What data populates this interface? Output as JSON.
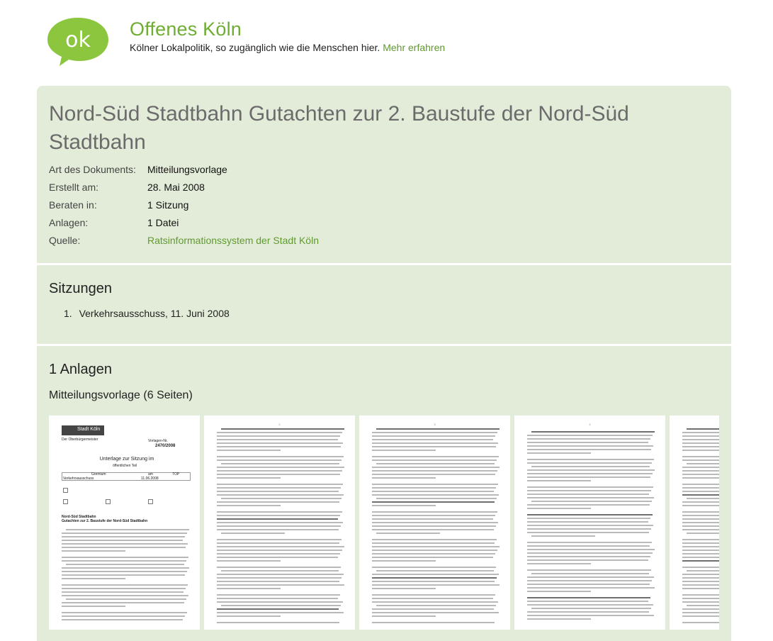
{
  "site": {
    "logo_text": "ok",
    "title": "Offenes Köln",
    "tagline": "Kölner Lokalpolitik, so zugänglich wie die Menschen hier.",
    "more_link": "Mehr erfahren",
    "brand_color": "#6fae33"
  },
  "document": {
    "title": "Nord-Süd Stadtbahn Gutachten zur 2. Baustufe der Nord-Süd Stadtbahn",
    "meta": [
      {
        "label": "Art des Dokuments:",
        "value": "Mitteilungsvorlage"
      },
      {
        "label": "Erstellt am:",
        "value": "28. Mai 2008"
      },
      {
        "label": "Beraten in:",
        "value": "1 Sitzung"
      },
      {
        "label": "Anlagen:",
        "value": "1 Datei"
      },
      {
        "label": "Quelle:",
        "value": "Ratsinformationssystem der Stadt Köln"
      }
    ]
  },
  "sitzungen": {
    "heading": "Sitzungen",
    "items": [
      {
        "num": "1.",
        "label": "Verkehrsausschuss, 11. Juni 2008"
      }
    ]
  },
  "anlagen": {
    "heading": "1 Anlagen",
    "attachment_title": "Mitteilungsvorlage (6 Seiten)",
    "page1": {
      "logo": "Stadt Köln",
      "dezernat": "Der Oberbürgermeister",
      "vorlagen_label": "Vorlagen-Nr.",
      "vorlagen_nr": "2470/2008",
      "heading": "Unterlage zur Sitzung im",
      "subheading": "öffentlichen Teil",
      "gremium": "Gremium",
      "gremium_value": "Verkehrsausschuss",
      "am": "am",
      "am_value": "11.06.2008",
      "top": "TOP",
      "betreff": "Nord-Süd Stadtbahn",
      "betreff_sub": "Gutachten zur 2. Baustufe der Nord-Süd Stadtbahn"
    },
    "page_numbers": [
      "2",
      "3",
      "4"
    ]
  },
  "colors": {
    "panel_bg": "#e3ecd9",
    "link": "#5f9a2e",
    "title_gray": "#6b6b6b"
  }
}
